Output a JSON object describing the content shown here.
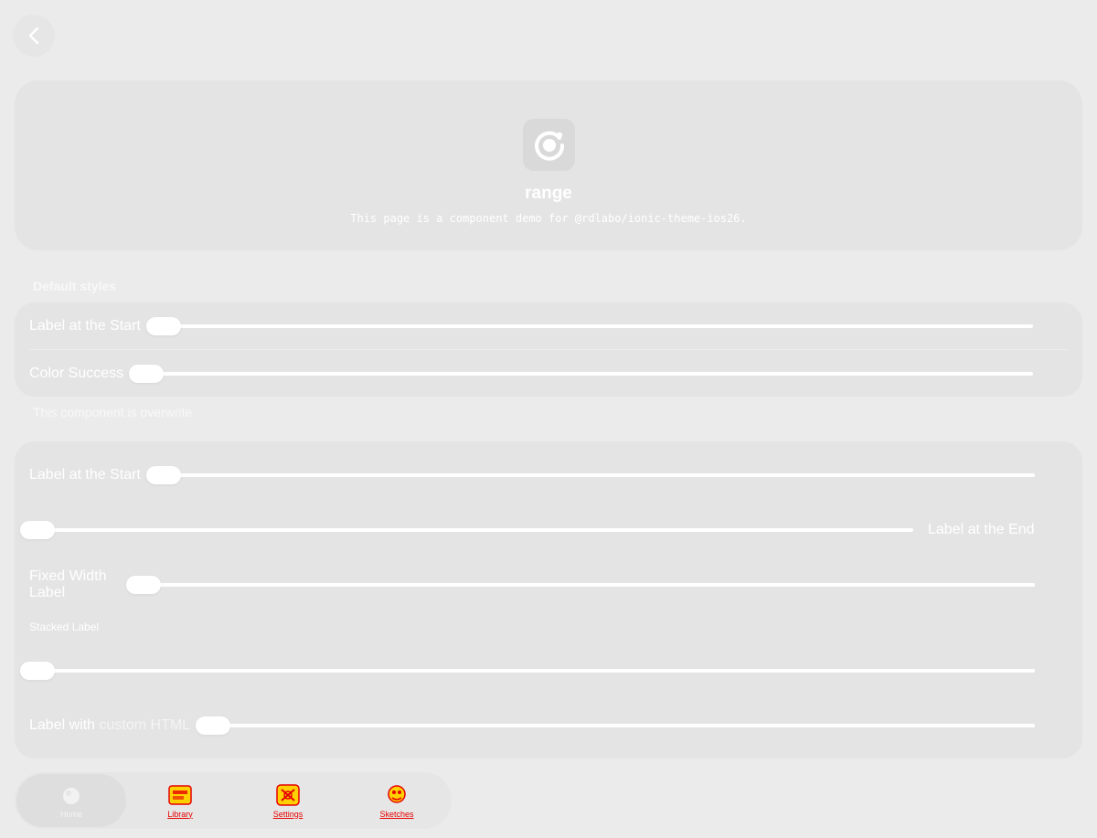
{
  "header": {
    "back_icon": "chevron-left-icon"
  },
  "hero": {
    "logo_icon": "ionic-logo-icon",
    "title": "range",
    "subtitle": "This page is a component demo for @rdlabo/ionic-theme-ios26."
  },
  "default_styles": {
    "header": "Default styles",
    "rows": [
      {
        "label": "Label at the Start"
      },
      {
        "label": "Color Success"
      }
    ]
  },
  "overwrite": {
    "note": "This component is overwrite.",
    "rows": [
      {
        "label": "Label at the Start"
      },
      {
        "label": "Label at the End"
      },
      {
        "label_line1": "Fixed Width",
        "label_line2": "Label"
      },
      {
        "label": "Stacked Label"
      },
      {
        "label_prefix": "Label with",
        "label_emphasis": "custom HTML"
      }
    ]
  },
  "range_values": {
    "default_label_start": 0,
    "default_color_success": 0,
    "overwrite_label_start": 0,
    "overwrite_label_end": 0,
    "overwrite_fixed_width": 0,
    "overwrite_stacked": 0,
    "overwrite_custom_html": 0
  },
  "tabbar": {
    "tabs": [
      {
        "label": "Home",
        "icon": "home-icon",
        "active": true
      },
      {
        "label": "Library",
        "icon": "library-icon",
        "active": false
      },
      {
        "label": "Settings",
        "icon": "settings-icon",
        "active": false
      },
      {
        "label": "Sketches",
        "icon": "sketches-icon",
        "active": false
      }
    ]
  },
  "colors": {
    "background": "#ebebeb",
    "card": "#e4e4e4",
    "text": "#ffffff",
    "tab_label": "#e60000"
  }
}
